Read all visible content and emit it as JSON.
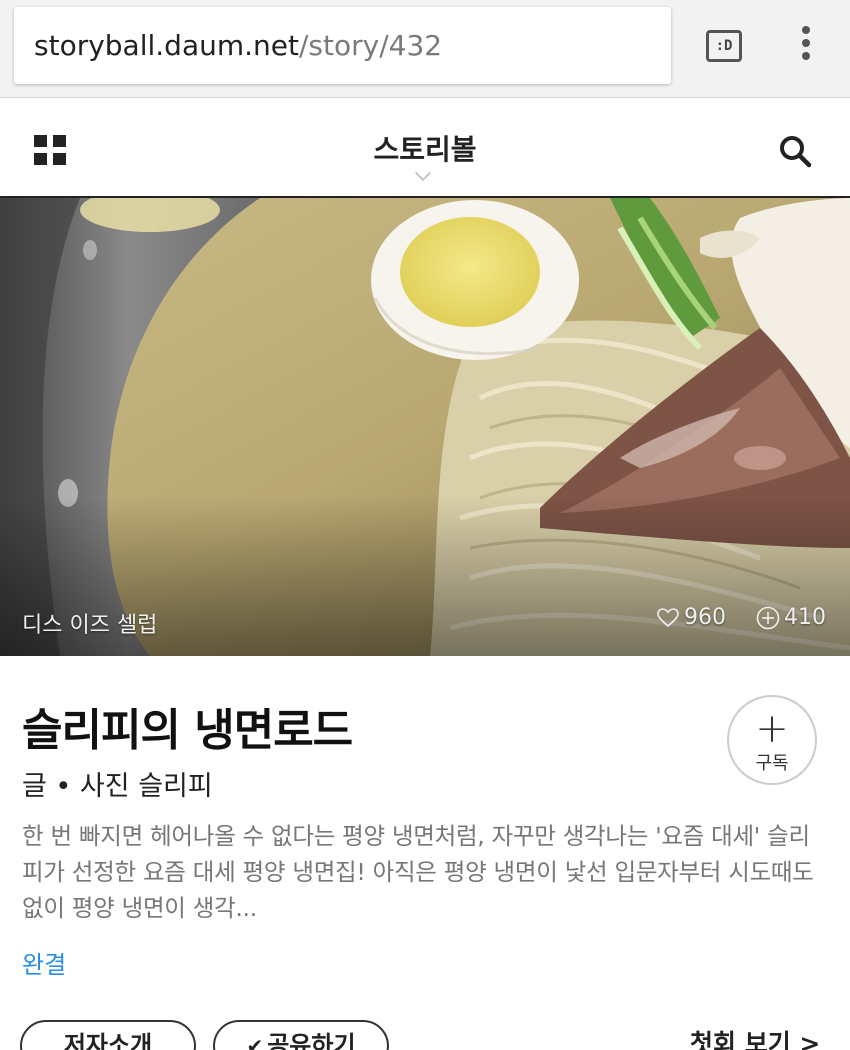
{
  "browser": {
    "url_host": "storyball.daum.net",
    "url_path": "/story/432",
    "tab_switcher_label": ":D",
    "menu_icon": "more-vert-icon"
  },
  "header": {
    "title": "스토리볼",
    "menu_icon": "grid-icon",
    "search_icon": "search-icon"
  },
  "hero": {
    "category_label": "디스 이즈 셀럽",
    "likes": "960",
    "subscribers": "410"
  },
  "story": {
    "title": "슬리피의 냉면로드",
    "byline": "글 • 사진 슬리피",
    "description": "한 번 빠지면 헤어나올 수 없다는 평양 냉면처럼, 자꾸만 생각나는 '요즘 대세' 슬리피가 선정한 요즘 대세 평양 냉면집! 아직은 평양 냉면이 낯선 입문자부터 시도때도 없이 평양 냉면이 생각...",
    "status": "완결",
    "subscribe_label": "구독"
  },
  "actions": {
    "author_label": "저자소개",
    "share_label": "공유하기",
    "first_view_label": "첫회 보기 >"
  },
  "colors": {
    "link_blue": "#2a8de0",
    "text_gray": "#777777"
  }
}
